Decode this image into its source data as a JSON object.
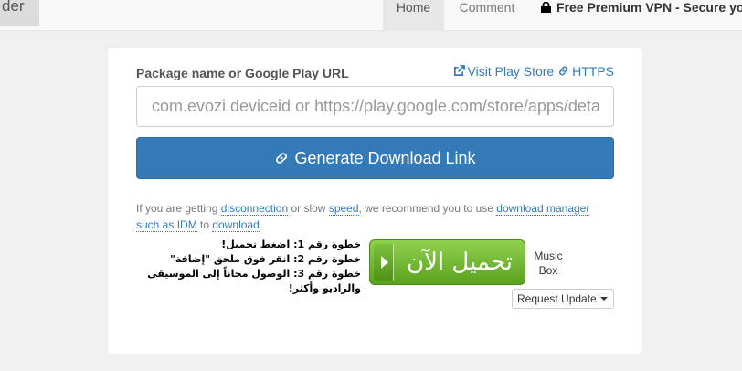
{
  "navbar": {
    "brand_fragment": "der",
    "home": "Home",
    "comment": "Comment",
    "vpn": "Free Premium VPN - Secure yo"
  },
  "form": {
    "label": "Package name or Google Play URL",
    "visit_play_store": "Visit Play Store",
    "https": "HTTPS",
    "input_placeholder": "com.evozi.deviceid or https://play.google.com/store/apps/deta",
    "generate_button": "Generate Download Link"
  },
  "info": {
    "t1": "If you are getting ",
    "l1": "disconnection",
    "t2": " or slow ",
    "l2": "speed",
    "t3": ", we recommend you to use ",
    "l3": "download manager such as IDM",
    "t4": " to ",
    "l4": "download"
  },
  "ad": {
    "steps": [
      "خطوة رقم 1: اضغط تحميل!",
      "خطوة رقم 2: انقر فوق ملحق \"إضافة\"",
      "خطوة رقم 3: الوصول مجاناً إلى الموسيقى والراديو وأكثر!"
    ],
    "button_text": "تحميل الآن",
    "brand_line1": "Music",
    "brand_line2": "Box"
  },
  "request_update": "Request Update",
  "colors": {
    "primary": "#337ab7",
    "ad_green": "#6cb52f",
    "background": "#f0f0f0"
  }
}
